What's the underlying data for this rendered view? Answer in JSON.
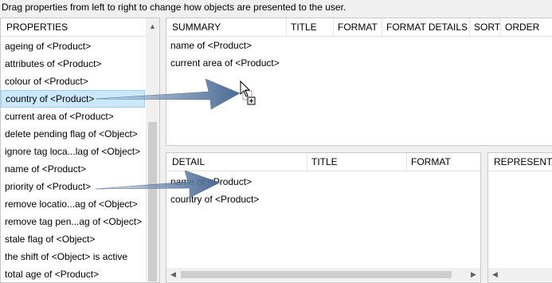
{
  "instruction": "Drag properties from left to right to change how objects are presented to the user.",
  "properties": {
    "header": "PROPERTIES",
    "items": [
      "ageing of <Product>",
      "attributes of <Product>",
      "colour of <Product>",
      "country of <Product>",
      "current area of <Product>",
      "delete pending flag of <Object>",
      "ignore tag loca...lag of <Object>",
      "name of <Product>",
      "priority of <Product>",
      "remove locatio...ag of <Object>",
      "remove tag pen...ag of <Object>",
      "stale flag of <Object>",
      "the shift of <Object> is active",
      "total age of <Product>"
    ],
    "selected_item": "country of <Product>"
  },
  "summary": {
    "columns": [
      "SUMMARY",
      "TITLE",
      "FORMAT",
      "FORMAT DETAILS",
      "SORT",
      "ORDER"
    ],
    "rows": [
      "name of <Product>",
      "current area of <Product>"
    ]
  },
  "detail": {
    "columns": [
      "DETAIL",
      "TITLE",
      "FORMAT"
    ],
    "rows": [
      "name of <Product>",
      "country of <Product>"
    ]
  },
  "representation": {
    "columns": [
      "REPRESENTAT"
    ]
  },
  "icons": {
    "scroll_up": "▲",
    "scroll_left": "◀",
    "scroll_right": "▶"
  }
}
